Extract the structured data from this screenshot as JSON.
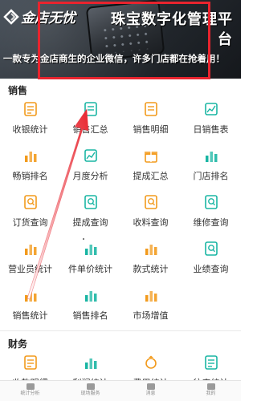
{
  "banner": {
    "brand_text": "金店无忧",
    "title": "珠宝数字化管理平台",
    "caption": "一款专为金店商生的企业微信，许多门店都在抢着用！"
  },
  "sections": [
    {
      "title": "销售",
      "items": [
        {
          "label": "收银统计",
          "icon": "cash-register-icon"
        },
        {
          "label": "销售汇总",
          "icon": "sales-summary-icon"
        },
        {
          "label": "销售明细",
          "icon": "sales-detail-icon"
        },
        {
          "label": "日销售表",
          "icon": "daily-sales-icon"
        },
        {
          "label": "畅销排名",
          "icon": "bestseller-rank-icon"
        },
        {
          "label": "月度分析",
          "icon": "monthly-analysis-icon"
        },
        {
          "label": "提成汇总",
          "icon": "commission-summary-icon"
        },
        {
          "label": "门店排名",
          "icon": "store-rank-icon"
        },
        {
          "label": "订货查询",
          "icon": "order-query-icon"
        },
        {
          "label": "提成查询",
          "icon": "commission-query-icon"
        },
        {
          "label": "收料查询",
          "icon": "material-query-icon"
        },
        {
          "label": "维修查询",
          "icon": "repair-query-icon"
        },
        {
          "label": "营业员统计",
          "icon": "salesperson-stats-icon"
        },
        {
          "label": "件单价统计",
          "icon": "unit-price-stats-icon"
        },
        {
          "label": "款式统计",
          "icon": "style-stats-icon"
        },
        {
          "label": "业绩查询",
          "icon": "performance-query-icon"
        },
        {
          "label": "销售统计",
          "icon": "sales-stats-icon"
        },
        {
          "label": "销售排名",
          "icon": "sales-rank-icon"
        },
        {
          "label": "市场增值",
          "icon": "market-growth-icon"
        }
      ]
    },
    {
      "title": "财务",
      "items": [
        {
          "label": "收款明细",
          "icon": "receipt-icon"
        },
        {
          "label": "利润统计",
          "icon": "profit-icon"
        },
        {
          "label": "费用统计",
          "icon": "expense-icon"
        },
        {
          "label": "往来统计",
          "icon": "ledger-icon"
        }
      ]
    }
  ],
  "bottom_nav": [
    {
      "label": "统计分析",
      "icon": "chart-icon"
    },
    {
      "label": "现场服务",
      "icon": "service-icon"
    },
    {
      "label": "消息",
      "icon": "message-icon"
    },
    {
      "label": "我的",
      "icon": "profile-icon"
    }
  ],
  "colors": {
    "blue": "#2f6fd6",
    "orange": "#f29a1c",
    "red": "#e8433b",
    "teal": "#19b5a3",
    "annotation": "#e8242e"
  }
}
